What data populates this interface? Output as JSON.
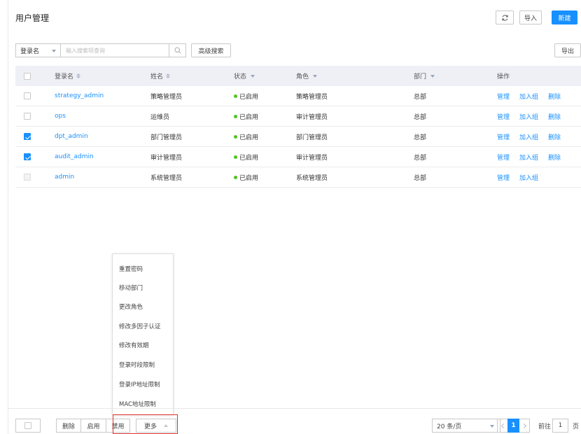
{
  "header": {
    "title": "用户管理",
    "refresh_icon": "refresh-icon",
    "import_label": "导入",
    "new_label": "新建",
    "accent": "#1890ff"
  },
  "toolbar": {
    "field_select": "登录名",
    "search_placeholder": "输入搜索项查询",
    "search_icon": "search-icon",
    "advanced_search_label": "高级搜索",
    "export_label": "导出"
  },
  "table": {
    "columns": {
      "login": "登录名",
      "name": "姓名",
      "status": "状态",
      "role": "角色",
      "dept": "部门",
      "ops": "操作"
    },
    "rows": [
      {
        "login": "strategy_admin",
        "name": "策略管理员",
        "status": "已启用",
        "role": "策略管理员",
        "dept": "总部",
        "checkbox": "unchecked",
        "ops": {
          "manage": "管理",
          "add_group": "加入组",
          "delete": "删除"
        }
      },
      {
        "login": "ops",
        "name": "运维员",
        "status": "已启用",
        "role": "审计管理员",
        "dept": "总部",
        "checkbox": "unchecked",
        "ops": {
          "manage": "管理",
          "add_group": "加入组",
          "delete": "删除"
        }
      },
      {
        "login": "dpt_admin",
        "name": "部门管理员",
        "status": "已启用",
        "role": "部门管理员",
        "dept": "总部",
        "checkbox": "checked",
        "ops": {
          "manage": "管理",
          "add_group": "加入组",
          "delete": "删除"
        }
      },
      {
        "login": "audit_admin",
        "name": "审计管理员",
        "status": "已启用",
        "role": "审计管理员",
        "dept": "总部",
        "checkbox": "checked",
        "ops": {
          "manage": "管理",
          "add_group": "加入组",
          "delete": "删除"
        }
      },
      {
        "login": "admin",
        "name": "系统管理员",
        "status": "已启用",
        "role": "系统管理员",
        "dept": "总部",
        "checkbox": "disabled",
        "ops": {
          "manage": "管理",
          "add_group": "加入组"
        }
      }
    ],
    "status_color": "#52c41a"
  },
  "more_menu": {
    "items": [
      "重置密码",
      "移动部门",
      "更改角色",
      "修改多因子认证",
      "修改有效期",
      "登录时段限制",
      "登录IP地址限制",
      "MAC地址限制"
    ]
  },
  "footer": {
    "delete_label": "删除",
    "enable_label": "启用",
    "disable_label": "禁用",
    "more_label": "更多",
    "highlight_color": "#e0312b"
  },
  "pagination": {
    "page_size": "20 条/页",
    "current_page": "1",
    "goto_label": "前往",
    "goto_value": "1",
    "goto_suffix": "页"
  }
}
